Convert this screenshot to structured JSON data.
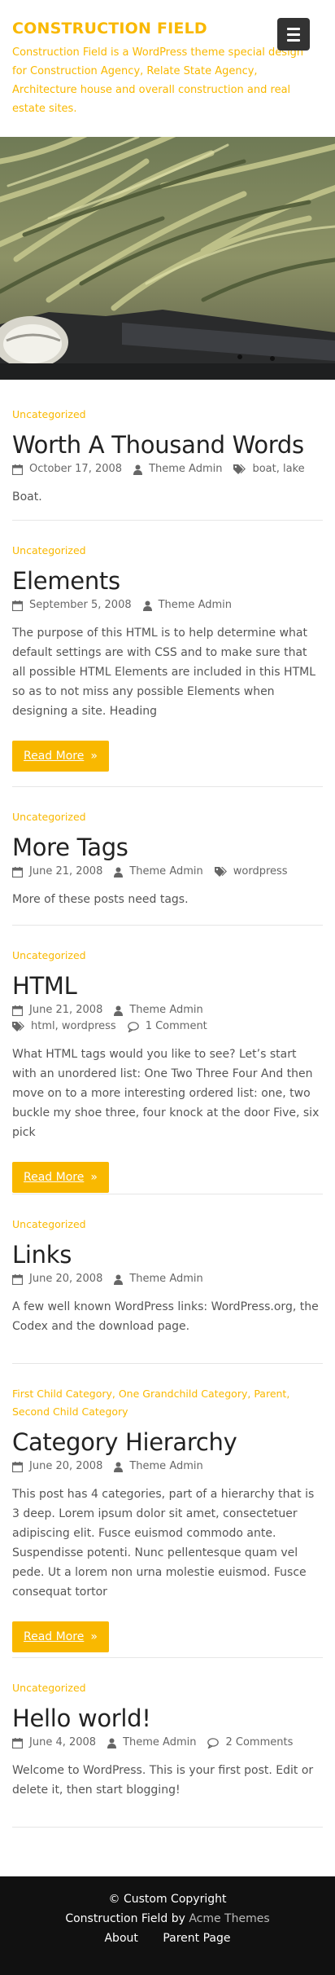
{
  "header": {
    "site_title": "CONSTRUCTION FIELD",
    "site_description": "Construction Field is a WordPress theme special design for Construction Agency, Relate State Agency, Architecture house and overall construction and real estate sites."
  },
  "posts": [
    {
      "categories": [
        "Uncategorized"
      ],
      "title": "Worth A Thousand Words",
      "date": "October 17, 2008",
      "author": "Theme Admin",
      "tags": "boat, lake",
      "comments": "",
      "excerpt": "Boat.",
      "read_more": ""
    },
    {
      "categories": [
        "Uncategorized"
      ],
      "title": "Elements",
      "date": "September 5, 2008",
      "author": "Theme Admin",
      "tags": "",
      "comments": "",
      "excerpt": "The purpose of this HTML is to help determine what default settings are with CSS and to make sure that all possible HTML Elements are included in this HTML so as to not miss any possible Elements when designing a site. Heading",
      "read_more": "Read More"
    },
    {
      "categories": [
        "Uncategorized"
      ],
      "title": "More Tags",
      "date": "June 21, 2008",
      "author": "Theme Admin",
      "tags": "wordpress",
      "comments": "",
      "excerpt": "More of these posts need tags.",
      "read_more": ""
    },
    {
      "categories": [
        "Uncategorized"
      ],
      "title": "HTML",
      "date": "June 21, 2008",
      "author": "Theme Admin",
      "tags": "html, wordpress",
      "comments": "1 Comment",
      "excerpt": "What HTML tags would you like to see? Let’s start with an unordered list: One Two Three Four And then move on to a more interesting ordered list: one, two buckle my shoe three, four knock at the door Five, six pick",
      "read_more": "Read More"
    },
    {
      "categories": [
        "Uncategorized"
      ],
      "title": "Links",
      "date": "June 20, 2008",
      "author": "Theme Admin",
      "tags": "",
      "comments": "",
      "excerpt": "A few well known WordPress links: WordPress.org, the Codex and the download page.",
      "read_more": ""
    },
    {
      "categories": [
        "First Child Category",
        "One Grandchild Category",
        "Parent",
        "Second Child Category"
      ],
      "title": "Category Hierarchy",
      "date": "June 20, 2008",
      "author": "Theme Admin",
      "tags": "",
      "comments": "",
      "excerpt": "This post has 4 categories, part of a hierarchy that is 3 deep. Lorem ipsum dolor sit amet, consectetuer adipiscing elit. Fusce euismod commodo ante. Suspendisse potenti. Nunc pellentesque quam vel pede. Ut a lorem non urna molestie euismod. Fusce consequat tortor",
      "read_more": "Read More"
    },
    {
      "categories": [
        "Uncategorized"
      ],
      "title": "Hello world!",
      "date": "June 4, 2008",
      "author": "Theme Admin",
      "tags": "",
      "comments": "2 Comments",
      "excerpt": "Welcome to WordPress. This is your first post. Edit or delete it, then start blogging!",
      "read_more": ""
    }
  ],
  "read_more_arrow": "»",
  "footer": {
    "copyright": "© Custom Copyright",
    "credit_prefix": "Construction Field by",
    "credit_link": "Acme Themes",
    "links": [
      "About",
      "Parent Page"
    ]
  },
  "colors": {
    "accent": "#f9b800",
    "footer_bg": "#111111",
    "menu_toggle_bg": "#333333"
  },
  "icons": {
    "menu": "hamburger-icon",
    "date": "calendar-icon",
    "author": "user-icon",
    "tags": "tags-icon",
    "comments": "comment-icon"
  }
}
